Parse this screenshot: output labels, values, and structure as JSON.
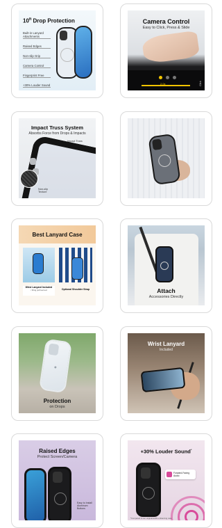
{
  "cards": [
    {
      "title_pre": "10",
      "title_sup": "ft",
      "title_post": " Drop Protection",
      "features": [
        "Built-in Lanyard Attachments",
        "Raised Edges",
        "Non-slip Grip",
        "Camera Control",
        "Fingerprint Free",
        "+30% Louder Sound"
      ]
    },
    {
      "title": "Camera Control",
      "subtitle": "Easy to Click, Press & Slide",
      "screen_label": "2.0x",
      "side_label": "Click"
    },
    {
      "title": "Impact Truss System",
      "subtitle": "Absorbs Force from Drops & Impacts",
      "callout_label": "Impact Truss",
      "texture_label": "Non-slip Texture"
    },
    {},
    {
      "title": "Best Lanyard Case",
      "left_caption": "Wrist Lanyard Included",
      "left_caption_sub": "/ Ring pull kerned",
      "right_caption": "Optional Shoulder Strap"
    },
    {
      "title": "Attach",
      "subtitle": "Accessories Directly"
    },
    {
      "title": "Protection",
      "subtitle": "on Drops"
    },
    {
      "title": "Wrist Lanyard",
      "subtitle": "Included"
    },
    {
      "title": "Raised Edges",
      "subtitle": "Protect Screen/Camera",
      "note": "Easy to Install Aluminum Buttons"
    },
    {
      "title": "+30% Louder Sound",
      "title_sup": "*",
      "badge": "Forward-Facing Audio",
      "footnote": "*Compared to our original audio enhancing case"
    }
  ],
  "colors": {
    "card_border": "#d9d9d9",
    "case_black": "#1a1a1a",
    "accent_blue": "#3a6bd6",
    "accent_yellow": "#f2c400",
    "pink_wave": "#d84a9a"
  }
}
